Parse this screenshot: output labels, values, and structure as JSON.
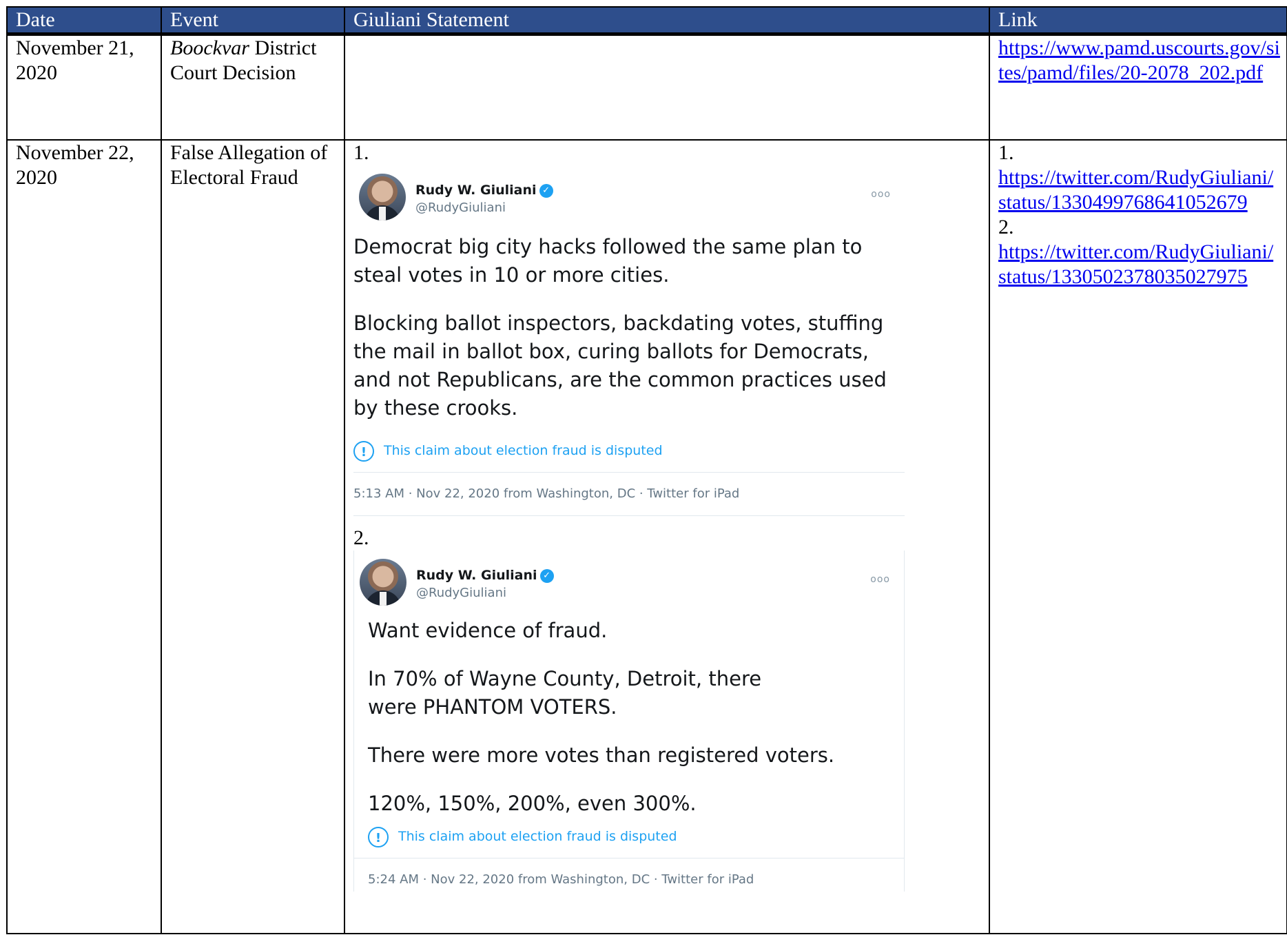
{
  "table": {
    "headers": [
      "Date",
      "Event",
      "Giuliani Statement",
      "Link"
    ],
    "rows": [
      {
        "date": "November 21, 2020",
        "event_italic": "Boockvar",
        "event_rest": " District Court Decision",
        "links": [
          {
            "number": "",
            "url": "https://www.pamd.uscourts.gov/sites/pamd/files/20-2078_202.pdf"
          }
        ]
      },
      {
        "date": "November 22, 2020",
        "event": "False Allegation of Electoral Fraud",
        "links": [
          {
            "number": "1.",
            "url": "https://twitter.com/RudyGiuliani/status/1330499768641052679"
          },
          {
            "number": "2.",
            "url": "https://twitter.com/RudyGiuliani/status/1330502378035027975"
          }
        ]
      }
    ]
  },
  "tweets": [
    {
      "number": "1.",
      "name": "Rudy W. Giuliani",
      "handle": "@RudyGiuliani",
      "more": "ooo",
      "paragraphs": [
        "Democrat big city hacks followed the same plan to steal votes in 10 or more cities.",
        "Blocking ballot inspectors, backdating votes, stuffing the mail in ballot box, curing ballots for Democrats, and not Republicans, are the common practices used by these crooks."
      ],
      "dispute": "This claim about election fraud is disputed",
      "meta": "5:13 AM · Nov 22, 2020 from Washington, DC · Twitter for iPad"
    },
    {
      "number": "2.",
      "name": "Rudy W. Giuliani",
      "handle": "@RudyGiuliani",
      "more": "ooo",
      "paragraphs": [
        "Want evidence of fraud.",
        "In 70% of Wayne County, Detroit, there were PHANTOM VOTERS.",
        "There were more votes than registered voters.",
        "120%, 150%, 200%, even 300%."
      ],
      "dispute": "This claim about election fraud is disputed",
      "meta": "5:24 AM · Nov 22, 2020 from Washington, DC · Twitter for iPad"
    }
  ],
  "colors": {
    "header_bg": "#2e4e8c",
    "link": "#0000ee",
    "twitter_blue": "#1da1f2"
  },
  "icons": {
    "verified": "verified-check-icon",
    "dispute": "exclamation-circle-icon",
    "more": "more-dots-icon"
  }
}
